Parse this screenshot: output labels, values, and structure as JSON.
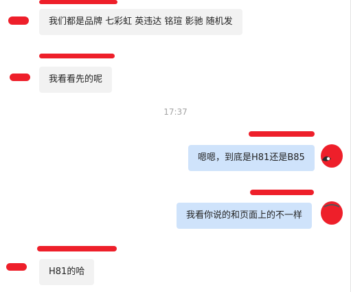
{
  "conversation": {
    "time_divider": "17:37",
    "messages": [
      {
        "direction": "incoming",
        "text": "我们都是品牌 七彩虹 英违达 铭瑄 影驰 随机发"
      },
      {
        "direction": "incoming",
        "text": "我看看先的呢"
      },
      {
        "direction": "outgoing",
        "text": "嗯嗯，到底是H81还是B85"
      },
      {
        "direction": "outgoing",
        "text": "我看你说的和页面上的不一样"
      },
      {
        "direction": "incoming",
        "text": "H81的哈"
      }
    ]
  },
  "colors": {
    "incoming_bubble": "#f2f2f2",
    "outgoing_bubble": "#cfe3fb",
    "redaction": "#ee1f2a",
    "time_text": "#a3a3a3"
  }
}
